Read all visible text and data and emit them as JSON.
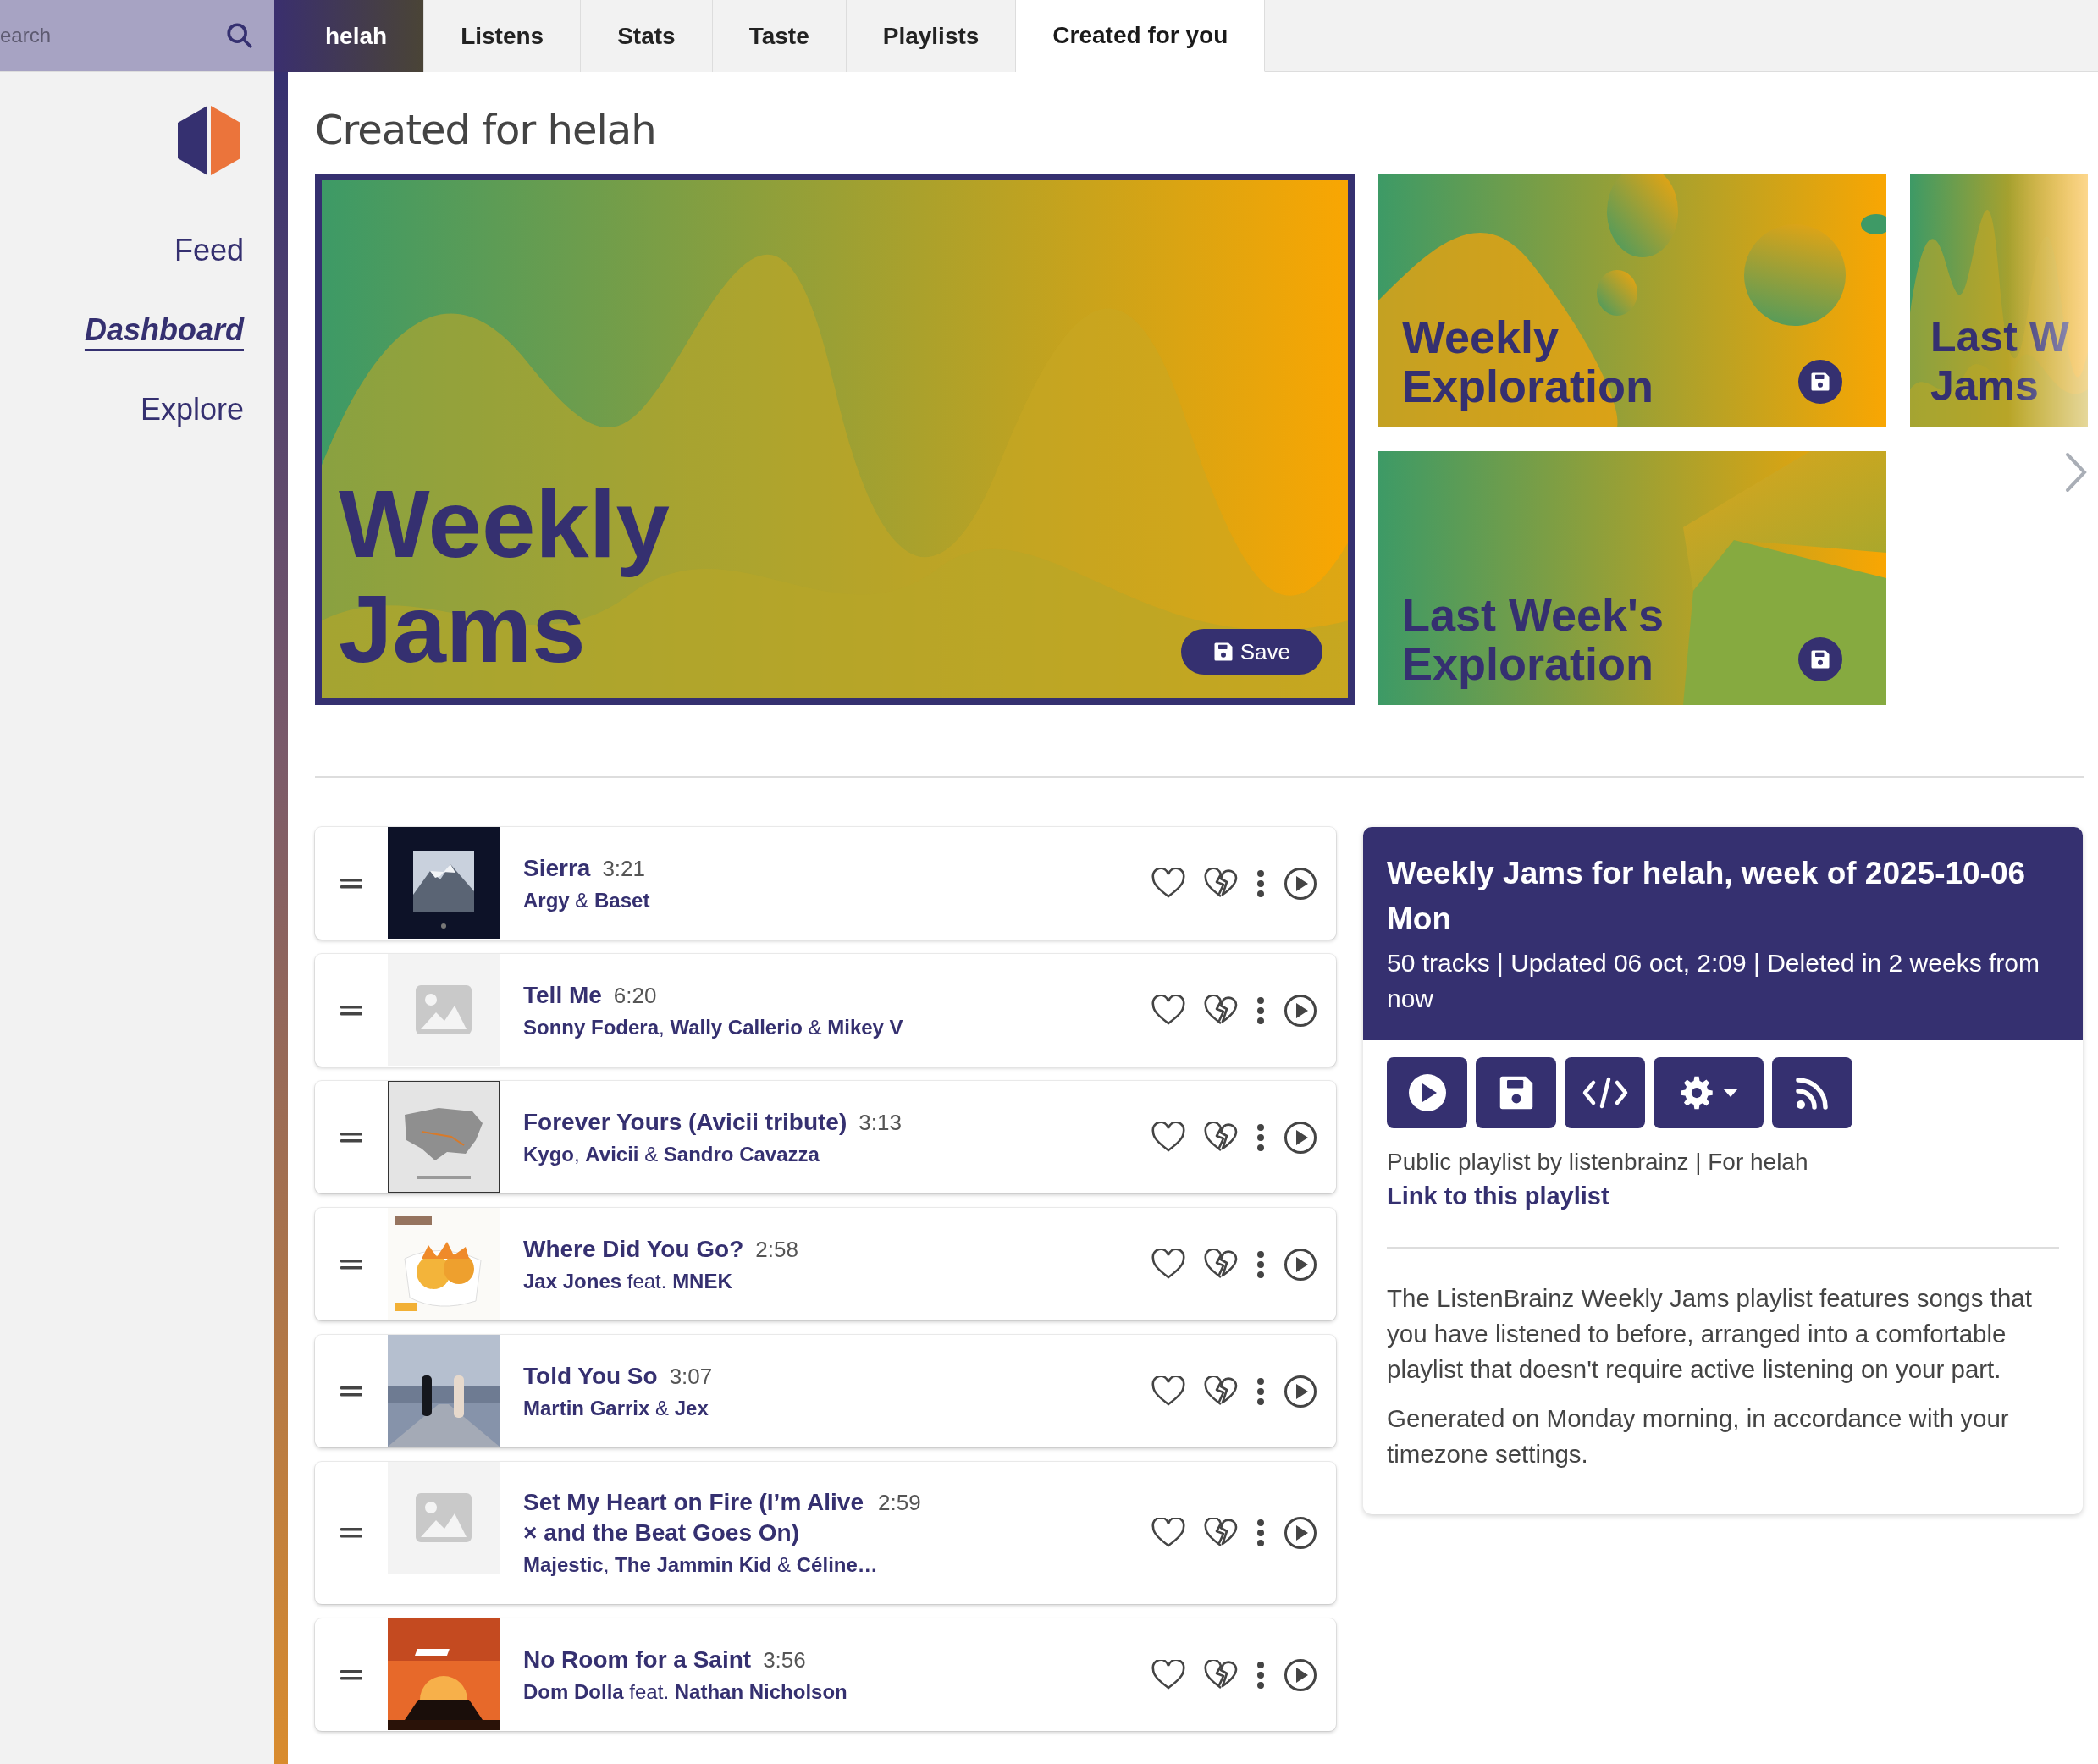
{
  "search": {
    "placeholder": "earch"
  },
  "tabs": [
    {
      "label": "helah",
      "kind": "user",
      "selected": false
    },
    {
      "label": "Listens",
      "kind": "page",
      "selected": false
    },
    {
      "label": "Stats",
      "kind": "page",
      "selected": false
    },
    {
      "label": "Taste",
      "kind": "page",
      "selected": false
    },
    {
      "label": "Playlists",
      "kind": "page",
      "selected": false
    },
    {
      "label": "Created for you",
      "kind": "page",
      "selected": true
    }
  ],
  "sidebar": {
    "items": [
      {
        "label": "Feed",
        "selected": false
      },
      {
        "label": "Dashboard",
        "selected": true
      },
      {
        "label": "Explore",
        "selected": false
      }
    ]
  },
  "page_title": "Created for helah",
  "playlist_cards": [
    {
      "title_lines": [
        "Weekly",
        "Jams"
      ],
      "kind": "waves",
      "selected": true,
      "save_label": "Save"
    },
    {
      "title_lines": [
        "Weekly",
        "Exploration"
      ],
      "kind": "blobs",
      "selected": false
    },
    {
      "title_lines": [
        "Last Week's",
        "Exploration"
      ],
      "kind": "slopes",
      "selected": false
    },
    {
      "title_lines": [
        "Last W",
        "Jams"
      ],
      "kind": "waves",
      "selected": false
    }
  ],
  "tracks": [
    {
      "title": "Sierra",
      "duration": "3:21",
      "artists": "**Argy** & **Baset**"
    },
    {
      "title": "Tell Me",
      "duration": "6:20",
      "artists": "**Sonny Fodera**, **Wally Callerio** & **Mikey V**",
      "cover": {
        "kind": "placeholder"
      }
    },
    {
      "title": "Forever Yours (Avicii tribute)",
      "duration": "3:13",
      "artists": "**Kygo**, **Avicii** & **Sandro Cavazza**"
    },
    {
      "title": "Where Did You Go?",
      "duration": "2:58",
      "artists": "**Jax Jones** feat. **MNEK**"
    },
    {
      "title": "Told You So",
      "duration": "3:07",
      "artists": "**Martin Garrix** & **Jex**"
    },
    {
      "title": "Set My Heart on Fire (I’m Alive × and the Beat Goes On)",
      "duration": "2:59",
      "artists": "**Majestic**, **The Jammin Kid** & **Céline…**",
      "cover": {
        "kind": "placeholder"
      }
    },
    {
      "title": "No Room for a Saint",
      "duration": "3:56",
      "artists": "**Dom Dolla** feat. **Nathan Nicholson**"
    }
  ],
  "playlist_panel": {
    "title": "Weekly Jams for helah, week of 2025-10-06 Mon",
    "meta": "50 tracks | Updated 06 oct, 2:09 | Deleted in 2 weeks from now",
    "owner": "Public playlist by listenbrainz | For helah",
    "link": "Link to this playlist",
    "description": [
      "The ListenBrainz Weekly Jams playlist features songs that you have listened to before, arranged into a comfortable playlist that doesn't require active listening on your part.",
      "Generated on Monday morning, in accordance with your timezone settings."
    ]
  }
}
